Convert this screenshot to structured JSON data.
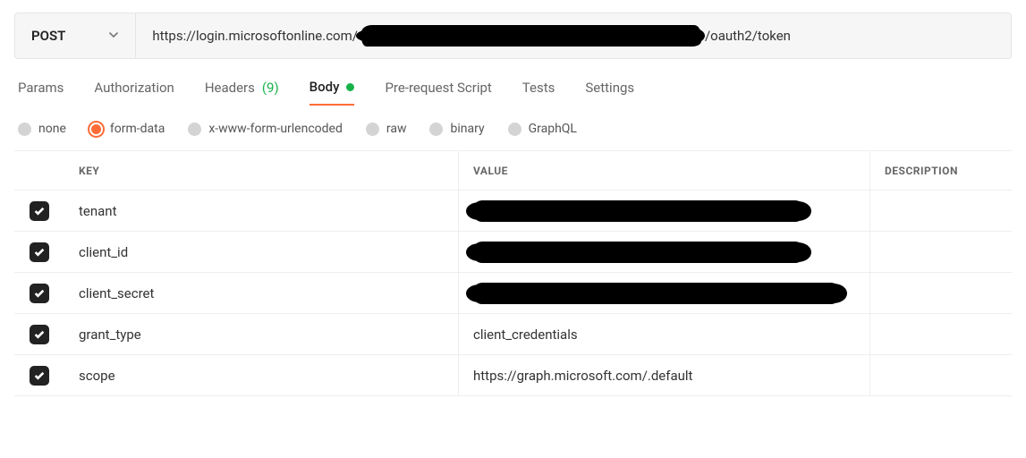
{
  "request": {
    "method": "POST",
    "url_prefix": "https://login.microsoftonline.com/",
    "url_suffix": "/oauth2/token"
  },
  "tabs": {
    "params": "Params",
    "authorization": "Authorization",
    "headers_label": "Headers",
    "headers_count": "(9)",
    "body": "Body",
    "prereq": "Pre-request Script",
    "tests": "Tests",
    "settings": "Settings"
  },
  "body_types": {
    "none": "none",
    "form_data": "form-data",
    "xwww": "x-www-form-urlencoded",
    "raw": "raw",
    "binary": "binary",
    "graphql": "GraphQL"
  },
  "kv_header": {
    "key": "KEY",
    "value": "VALUE",
    "description": "DESCRIPTION"
  },
  "rows": [
    {
      "key": "tenant",
      "value": "",
      "redacted": true
    },
    {
      "key": "client_id",
      "value": "",
      "redacted": true
    },
    {
      "key": "client_secret",
      "value": "",
      "redacted": true
    },
    {
      "key": "grant_type",
      "value": "client_credentials",
      "redacted": false
    },
    {
      "key": "scope",
      "value": "https://graph.microsoft.com/.default",
      "redacted": false
    }
  ]
}
